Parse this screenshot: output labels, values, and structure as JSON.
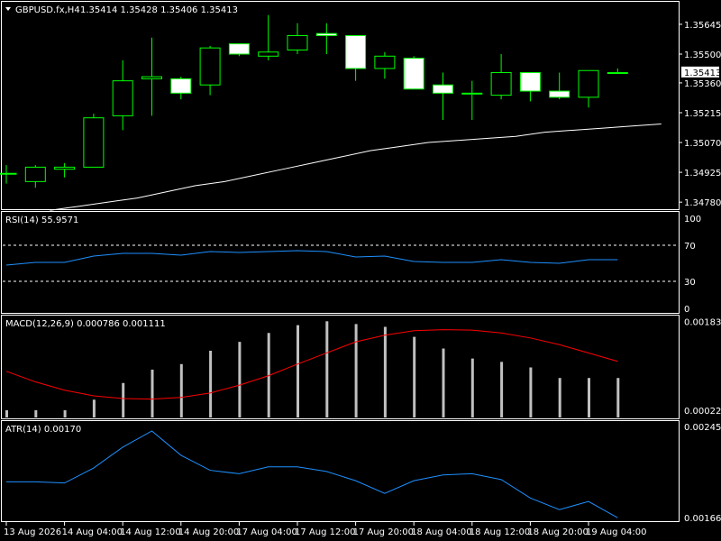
{
  "colors": {
    "background": "#000000",
    "frame": "#ffffff",
    "bull_body": "#000000",
    "bear_body": "#ffffff",
    "candle_outline": "#00ff00",
    "ma_line": "#ffffff",
    "rsi_line": "#1e90ff",
    "macd_hist": "#c0c0c0",
    "macd_signal": "#ff0000",
    "atr_line": "#1e90ff",
    "current_price_tag": "#ffffff"
  },
  "header": {
    "symbol_label": "GBPUSD.fx,H4",
    "ohlc_label": "1.35414 1.35428 1.35406 1.35413"
  },
  "chart_data": [
    {
      "type": "candlestick",
      "name": "price",
      "ylim": [
        1.3475,
        1.3575
      ],
      "y_ticks": [
        "1.35645",
        "1.35500",
        "1.35360",
        "1.35215",
        "1.35070",
        "1.34925",
        "1.34780"
      ],
      "y_tick_values": [
        1.35645,
        1.355,
        1.3536,
        1.35215,
        1.3507,
        1.34925,
        1.3478
      ],
      "current_price": "1.35413",
      "current_price_value": 1.35413,
      "candles": [
        {
          "o": 1.3492,
          "h": 1.3496,
          "l": 1.3487,
          "c": 1.3492
        },
        {
          "o": 1.3488,
          "h": 1.3496,
          "l": 1.3485,
          "c": 1.3495
        },
        {
          "o": 1.3494,
          "h": 1.3497,
          "l": 1.349,
          "c": 1.3495
        },
        {
          "o": 1.3495,
          "h": 1.3521,
          "l": 1.3495,
          "c": 1.3519
        },
        {
          "o": 1.352,
          "h": 1.3547,
          "l": 1.3513,
          "c": 1.3537
        },
        {
          "o": 1.3538,
          "h": 1.3558,
          "l": 1.352,
          "c": 1.3539
        },
        {
          "o": 1.3538,
          "h": 1.3539,
          "l": 1.3528,
          "c": 1.3531
        },
        {
          "o": 1.3535,
          "h": 1.3554,
          "l": 1.353,
          "c": 1.3553
        },
        {
          "o": 1.3555,
          "h": 1.3555,
          "l": 1.3549,
          "c": 1.355
        },
        {
          "o": 1.3549,
          "h": 1.3569,
          "l": 1.3547,
          "c": 1.3551
        },
        {
          "o": 1.3552,
          "h": 1.3565,
          "l": 1.355,
          "c": 1.3559
        },
        {
          "o": 1.356,
          "h": 1.3565,
          "l": 1.355,
          "c": 1.3559
        },
        {
          "o": 1.3559,
          "h": 1.3559,
          "l": 1.3537,
          "c": 1.3543
        },
        {
          "o": 1.3543,
          "h": 1.3551,
          "l": 1.3538,
          "c": 1.3549
        },
        {
          "o": 1.3548,
          "h": 1.3549,
          "l": 1.3533,
          "c": 1.3533
        },
        {
          "o": 1.3535,
          "h": 1.3541,
          "l": 1.3518,
          "c": 1.3531
        },
        {
          "o": 1.3531,
          "h": 1.3537,
          "l": 1.3518,
          "c": 1.3531
        },
        {
          "o": 1.353,
          "h": 1.355,
          "l": 1.3528,
          "c": 1.3541
        },
        {
          "o": 1.3541,
          "h": 1.3541,
          "l": 1.3527,
          "c": 1.3532
        },
        {
          "o": 1.3532,
          "h": 1.3541,
          "l": 1.3528,
          "c": 1.3529
        },
        {
          "o": 1.3529,
          "h": 1.3542,
          "l": 1.3524,
          "c": 1.3542
        },
        {
          "o": 1.3541,
          "h": 1.3543,
          "l": 1.3541,
          "c": 1.3541
        }
      ],
      "moving_average": [
        1.3474,
        1.3476,
        1.3478,
        1.348,
        1.3483,
        1.3486,
        1.3488,
        1.3491,
        1.3494,
        1.3497,
        1.35,
        1.3503,
        1.3505,
        1.3507,
        1.3508,
        1.3509,
        1.351,
        1.3512,
        1.3513,
        1.3514,
        1.3515,
        1.3516
      ]
    },
    {
      "type": "line",
      "name": "rsi",
      "label": "RSI(14) 55.9571",
      "ylim": [
        0,
        100
      ],
      "y_ticks": [
        "100",
        "70",
        "30",
        "0"
      ],
      "y_tick_values": [
        100,
        70,
        30,
        0
      ],
      "levels": [
        70,
        30
      ],
      "values": [
        48,
        51,
        51,
        58,
        61,
        61,
        59,
        63,
        62,
        63,
        64,
        63,
        57,
        58,
        52,
        51,
        51,
        54,
        51,
        50,
        54,
        54
      ]
    },
    {
      "type": "bar",
      "name": "macd",
      "label": "MACD(12,26,9) 0.000786 0.001111",
      "ylim": [
        0.0001,
        0.0019
      ],
      "y_ticks": [
        "0.001831",
        "0.000227"
      ],
      "y_tick_values": [
        0.001831,
        0.000227
      ],
      "histogram": [
        0.00023,
        0.00023,
        0.00023,
        0.00042,
        0.00072,
        0.00096,
        0.00106,
        0.0013,
        0.00146,
        0.00162,
        0.00176,
        0.00183,
        0.00178,
        0.00173,
        0.00155,
        0.00134,
        0.00116,
        0.0011,
        0.001,
        0.00081,
        0.00081,
        0.00081
      ],
      "signal": [
        0.00093,
        0.00074,
        0.00059,
        0.00049,
        0.00044,
        0.00043,
        0.00046,
        0.00054,
        0.00068,
        0.00085,
        0.00106,
        0.00126,
        0.00146,
        0.00158,
        0.00166,
        0.00168,
        0.00167,
        0.00162,
        0.00153,
        0.00141,
        0.00126,
        0.00111
      ]
    },
    {
      "type": "line",
      "name": "atr",
      "label": "ATR(14) 0.00170",
      "ylim": [
        0.00163,
        0.00248
      ],
      "y_ticks": [
        "0.00245",
        "0.00166"
      ],
      "y_tick_values": [
        0.00245,
        0.00166
      ],
      "values": [
        0.00197,
        0.00197,
        0.00196,
        0.00209,
        0.00227,
        0.00241,
        0.0022,
        0.00207,
        0.00204,
        0.0021,
        0.0021,
        0.00206,
        0.00198,
        0.00187,
        0.00198,
        0.00203,
        0.00204,
        0.00199,
        0.00183,
        0.00173,
        0.0018,
        0.00166
      ]
    }
  ],
  "x_axis": {
    "labels": [
      "13 Aug 2026",
      "14 Aug 04:00",
      "14 Aug 12:00",
      "14 Aug 20:00",
      "17 Aug 04:00",
      "17 Aug 12:00",
      "17 Aug 20:00",
      "18 Aug 04:00",
      "18 Aug 12:00",
      "18 Aug 20:00",
      "19 Aug 04:00"
    ],
    "label_candle_index": [
      0,
      2,
      4,
      6,
      8,
      10,
      12,
      14,
      16,
      18,
      20
    ]
  }
}
